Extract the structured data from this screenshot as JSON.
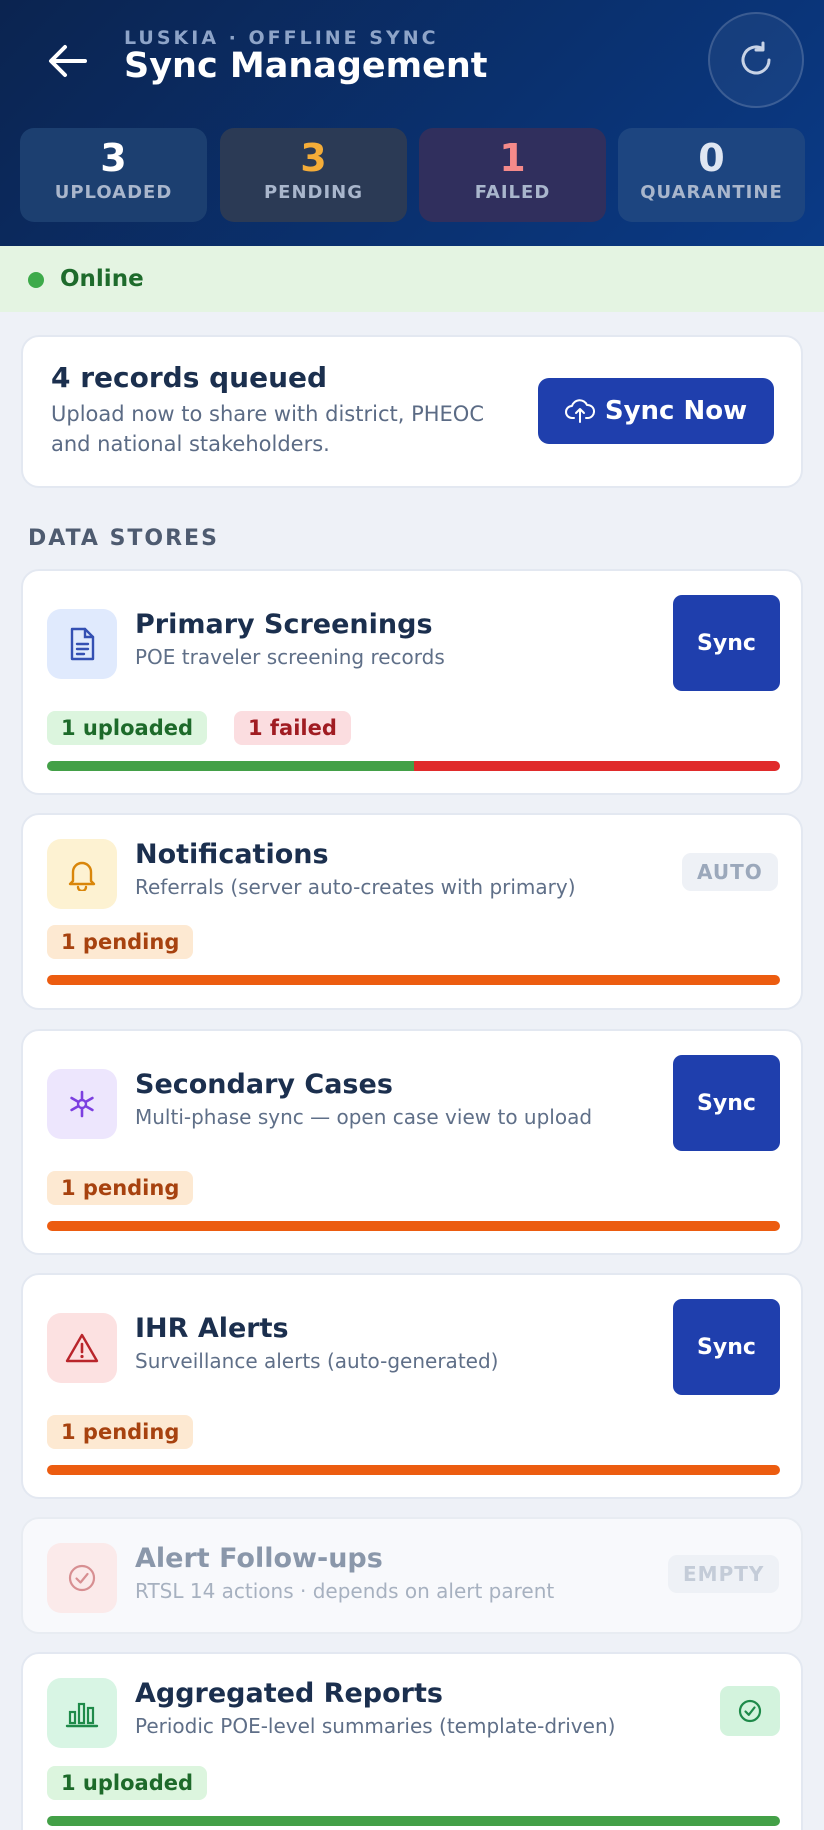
{
  "header": {
    "overline": "LUSKIA · OFFLINE SYNC",
    "title": "Sync Management",
    "back_icon": "arrow-left-icon",
    "refresh_icon": "refresh-icon"
  },
  "stats": [
    {
      "value": "3",
      "label": "UPLOADED",
      "color": "#ffffff"
    },
    {
      "value": "3",
      "label": "PENDING",
      "color": "#f4ac38"
    },
    {
      "value": "1",
      "label": "FAILED",
      "color": "#f48a8a"
    },
    {
      "value": "0",
      "label": "QUARANTINE",
      "color": "#dfe6f2"
    }
  ],
  "status": {
    "label": "Online",
    "color": "#3daa4a"
  },
  "queue": {
    "title": "4 records queued",
    "subtitle": "Upload now to share with district, PHEOC and national stakeholders.",
    "button_label": "Sync Now",
    "button_icon": "cloud-upload-icon"
  },
  "section_title": "DATA STORES",
  "stores": [
    {
      "name": "Primary Screenings",
      "description": "POE traveler screening records",
      "icon": "document-icon",
      "action": "Sync",
      "badges": [
        "1 uploaded",
        "1 failed"
      ],
      "progress": {
        "uploaded": 0.5,
        "failed": 0.5,
        "pending": 0
      }
    },
    {
      "name": "Notifications",
      "description": "Referrals (server auto-creates with primary)",
      "icon": "bell-icon",
      "tag": "AUTO",
      "badges": [
        "1 pending"
      ],
      "progress": {
        "uploaded": 0,
        "failed": 0,
        "pending": 1
      }
    },
    {
      "name": "Secondary Cases",
      "description": "Multi-phase sync — open case view to upload",
      "icon": "asterisk-icon",
      "action": "Sync",
      "badges": [
        "1 pending"
      ],
      "progress": {
        "uploaded": 0,
        "failed": 0,
        "pending": 1
      }
    },
    {
      "name": "IHR Alerts",
      "description": "Surveillance alerts (auto-generated)",
      "icon": "warning-triangle-icon",
      "action": "Sync",
      "badges": [
        "1 pending"
      ],
      "progress": {
        "uploaded": 0,
        "failed": 0,
        "pending": 1
      }
    },
    {
      "name": "Alert Follow-ups",
      "description": "RTSL 14 actions · depends on alert parent",
      "icon": "check-circle-icon",
      "tag": "EMPTY"
    },
    {
      "name": "Aggregated Reports",
      "description": "Periodic POE-level summaries (template-driven)",
      "icon": "bar-chart-icon",
      "status_icon": "check-circle-icon",
      "badges": [
        "1 uploaded"
      ],
      "progress": {
        "uploaded": 1,
        "failed": 0,
        "pending": 0
      }
    }
  ],
  "colors": {
    "primary": "#1f3fad",
    "uploaded": "#43a047",
    "failed": "#e02b2b",
    "pending": "#ec5c10"
  }
}
